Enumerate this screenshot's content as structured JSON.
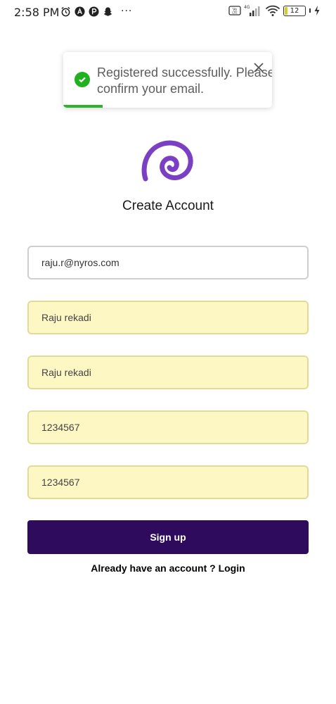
{
  "status_bar": {
    "time": "2:58 PM",
    "dots": "···",
    "battery_level": "12",
    "network": "4G"
  },
  "toast": {
    "message": "Registered successfully. Please confirm your email.",
    "progress": 0.19,
    "accent_color": "#1fb11f"
  },
  "page": {
    "title": "Create Account"
  },
  "form": {
    "email_value": "raju.r@nyros.com",
    "first_name_value": "Raju rekadi",
    "last_name_value": "Raju rekadi",
    "password_value": "1234567",
    "confirm_password_value": "1234567",
    "submit_label": "Sign up",
    "login_prompt": "Already have an account ? Login"
  },
  "colors": {
    "primary_button": "#2e0b5d",
    "logo": "#7b3fc4",
    "autofill_background": "#fdf7c3"
  }
}
